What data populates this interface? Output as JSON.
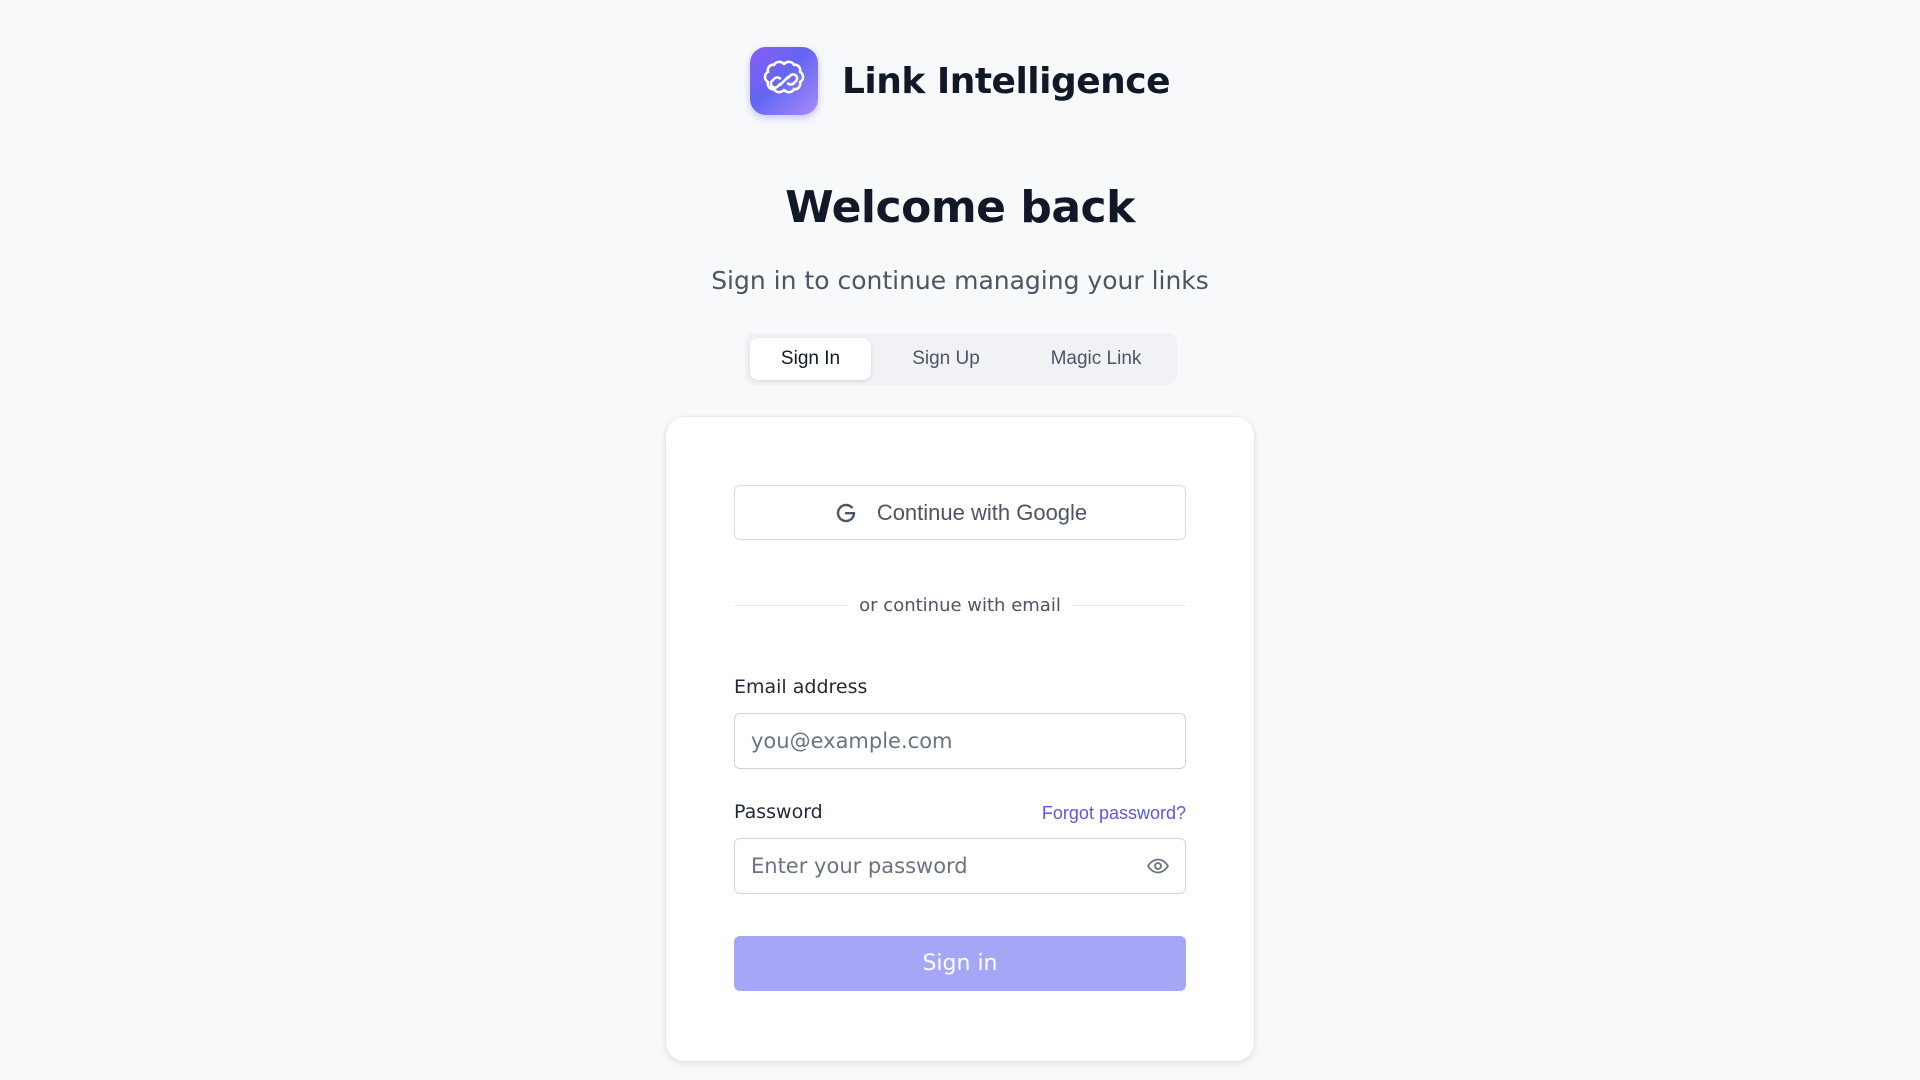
{
  "brand": {
    "name": "Link Intelligence",
    "logo_icon": "brain-link-icon"
  },
  "header": {
    "title": "Welcome back",
    "subtitle": "Sign in to continue managing your links"
  },
  "tabs": [
    {
      "label": "Sign In",
      "active": true
    },
    {
      "label": "Sign Up",
      "active": false
    },
    {
      "label": "Magic Link",
      "active": false
    }
  ],
  "form": {
    "google_button_label": "Continue with Google",
    "google_icon": "google-g-icon",
    "divider_text": "or continue with email",
    "email": {
      "label": "Email address",
      "placeholder": "you@example.com",
      "value": ""
    },
    "password": {
      "label": "Password",
      "placeholder": "Enter your password",
      "value": "",
      "toggle_icon": "eye-icon"
    },
    "forgot_password_label": "Forgot password?",
    "submit_label": "Sign in"
  },
  "colors": {
    "background": "#f8f9fb",
    "accent": "#5b5bd6",
    "submit_disabled": "#a5a6f6",
    "logo_gradient_start": "#8b5cf6",
    "logo_gradient_end": "#6366f1"
  }
}
